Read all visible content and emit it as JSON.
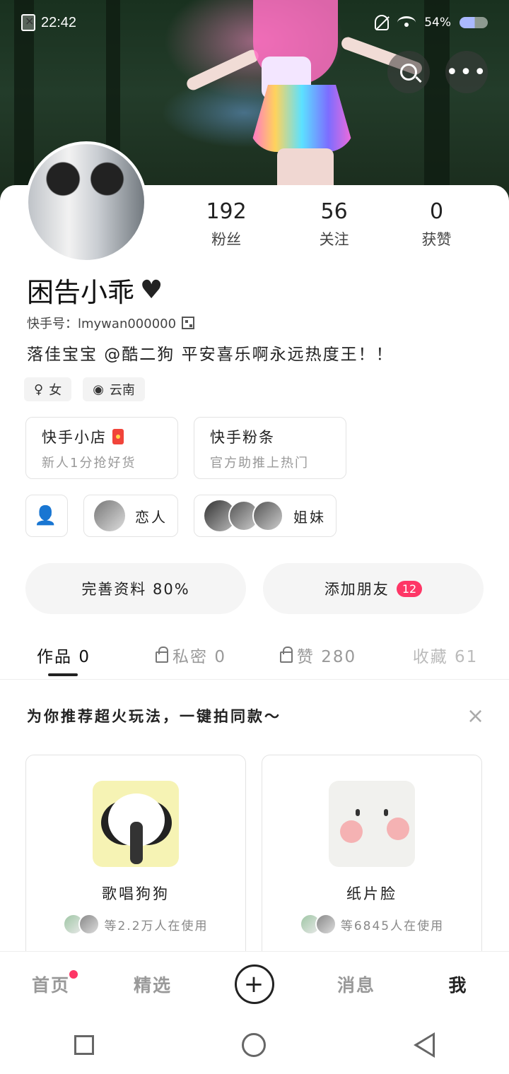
{
  "status": {
    "time": "22:42",
    "battery": "54%"
  },
  "profile": {
    "followers": "192",
    "followers_label": "粉丝",
    "following": "56",
    "following_label": "关注",
    "likes": "0",
    "likes_label": "获赞",
    "nickname": "困告小乖",
    "uid": "快手号：lmywan000000",
    "bio": "落佳宝宝  @酷二狗  平安喜乐啊永远热度王！！",
    "gender": "女",
    "location": "云南"
  },
  "cards": [
    {
      "title": "快手小店",
      "subtitle": "新人1分抢好货"
    },
    {
      "title": "快手粉条",
      "subtitle": "官方助推上热门"
    }
  ],
  "relations": {
    "lover": "恋人",
    "sisters": "姐妹"
  },
  "actions": {
    "complete_profile": "完善资料 80%",
    "add_friends": "添加朋友",
    "add_friends_count": "12"
  },
  "tabs": [
    {
      "label": "作品 0"
    },
    {
      "label": "私密 0"
    },
    {
      "label": "赞 280"
    },
    {
      "label": "收藏 61"
    }
  ],
  "recommend": {
    "header": "为你推荐超火玩法，一键拍同款～",
    "items": [
      {
        "title": "歌唱狗狗",
        "users": "等2.2万人在使用"
      },
      {
        "title": "纸片脸",
        "users": "等6845人在使用"
      }
    ]
  },
  "nav": {
    "home": "首页",
    "featured": "精选",
    "plus": "+",
    "messages": "消息",
    "me": "我"
  },
  "colors": {
    "accent": "#fe3666"
  }
}
